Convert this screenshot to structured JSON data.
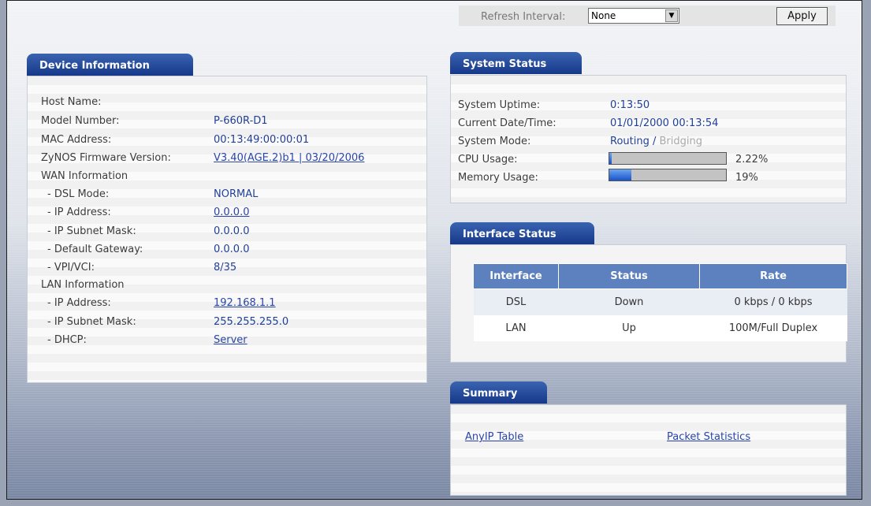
{
  "toolbar": {
    "refresh_label": "Refresh Interval:",
    "refresh_value": "None",
    "apply_label": "Apply"
  },
  "device_info": {
    "title": "Device Information",
    "rows": [
      {
        "label": "Host Name:",
        "value": ""
      },
      {
        "label": "Model Number:",
        "value": "P-660R-D1"
      },
      {
        "label": "MAC Address:",
        "value": "00:13:49:00:00:01"
      },
      {
        "label": "ZyNOS Firmware Version:",
        "value": "V3.40(AGE.2)b1 | 03/20/2006"
      },
      {
        "label": "WAN Information",
        "value": ""
      },
      {
        "label": "- DSL Mode:",
        "value": "NORMAL"
      },
      {
        "label": "- IP Address:",
        "value": "0.0.0.0"
      },
      {
        "label": "- IP Subnet Mask:",
        "value": "0.0.0.0"
      },
      {
        "label": "- Default Gateway:",
        "value": "0.0.0.0"
      },
      {
        "label": "- VPI/VCI:",
        "value": "8/35"
      },
      {
        "label": "LAN Information",
        "value": ""
      },
      {
        "label": "- IP Address:",
        "value": "192.168.1.1"
      },
      {
        "label": "- IP Subnet Mask:",
        "value": "255.255.255.0"
      },
      {
        "label": "- DHCP:",
        "value": "Server"
      }
    ]
  },
  "system_status": {
    "title": "System Status",
    "uptime_label": "System Uptime:",
    "uptime_value": "0:13:50",
    "datetime_label": "Current Date/Time:",
    "datetime_value": "01/01/2000 00:13:54",
    "mode_label": "System Mode:",
    "mode_routing": "Routing",
    "mode_separator": " / ",
    "mode_bridging": "Bridging",
    "cpu_label": "CPU Usage:",
    "cpu_value": "2.22%",
    "cpu_fraction": 0.0222,
    "memory_label": "Memory Usage:",
    "memory_value": "19%",
    "memory_fraction": 0.19
  },
  "interface_status": {
    "title": "Interface Status",
    "headers": [
      "Interface",
      "Status",
      "Rate"
    ],
    "rows": [
      {
        "interface": "DSL",
        "status": "Down",
        "rate": "0 kbps / 0 kbps"
      },
      {
        "interface": "LAN",
        "status": "Up",
        "rate": "100M/Full Duplex"
      }
    ]
  },
  "summary": {
    "title": "Summary",
    "anyip_link": "AnyIP Table",
    "packet_link": "Packet Statistics"
  },
  "colors": {
    "tab_blue": "#1d3f8f",
    "link_blue": "#2a45a8",
    "table_header": "#5d80be"
  }
}
